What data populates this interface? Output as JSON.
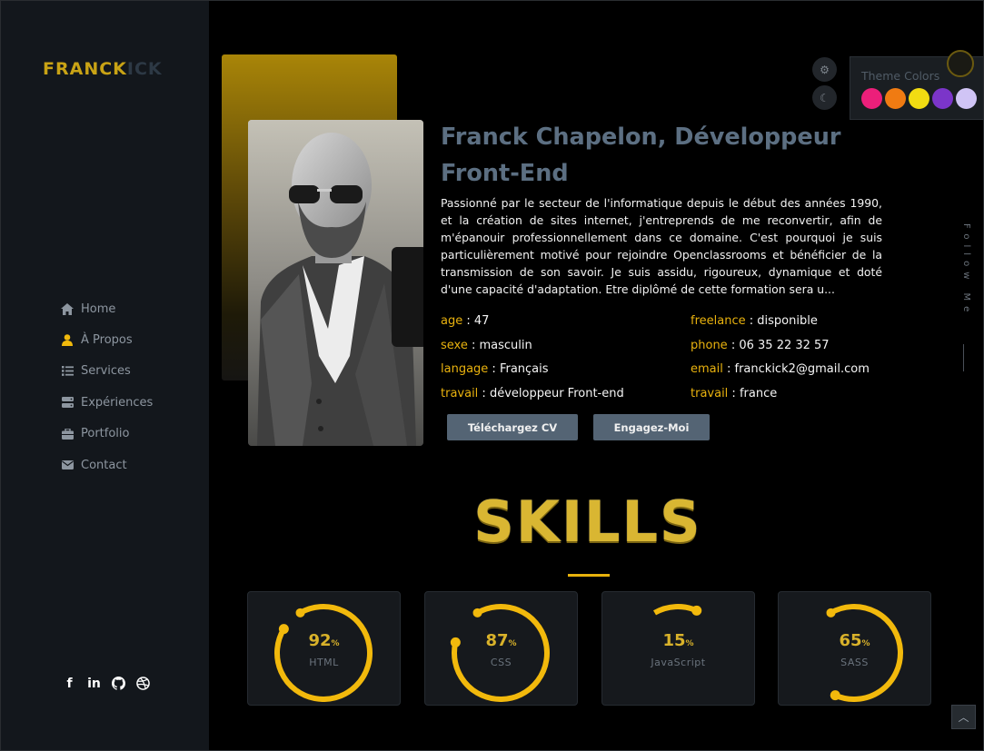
{
  "logo": {
    "part1": "FRANCK",
    "part2": "ICK"
  },
  "nav": [
    {
      "label": "Home",
      "icon": "home-icon"
    },
    {
      "label": "À Propos",
      "icon": "user-icon"
    },
    {
      "label": "Services",
      "icon": "list-icon"
    },
    {
      "label": "Expériences",
      "icon": "server-icon"
    },
    {
      "label": "Portfolio",
      "icon": "briefcase-icon"
    },
    {
      "label": "Contact",
      "icon": "envelope-icon"
    }
  ],
  "socials": [
    "facebook-icon",
    "linkedin-icon",
    "github-icon",
    "dribbble-icon"
  ],
  "hero": {
    "name": "Franck Chapelon, Développeur Front-End",
    "bio": "Passionné par le secteur de l'informatique depuis le début des années 1990, et la création de sites internet, j'entreprends de me reconvertir, afin de m'épanouir professionnellement dans ce domaine. C'est pourquoi je suis particulièrement motivé pour rejoindre Openclassrooms et bénéficier de la transmission de son savoir. Je suis assidu, rigoureux, dynamique et doté d'une capacité d'adaptation. Etre diplômé de cette formation sera u...",
    "info_left": [
      {
        "key": "age",
        "value": "47"
      },
      {
        "key": "sexe",
        "value": "masculin"
      },
      {
        "key": "langage",
        "value": "Français"
      },
      {
        "key": "travail",
        "value": "développeur Front-end"
      }
    ],
    "info_right": [
      {
        "key": "freelance",
        "value": "disponible"
      },
      {
        "key": "phone",
        "value": "06 35 22 32 57"
      },
      {
        "key": "email",
        "value": "franckick2@gmail.com"
      },
      {
        "key": "travail",
        "value": "france"
      }
    ],
    "buttons": {
      "cv": "Téléchargez CV",
      "hire": "Engagez-Moi"
    }
  },
  "theme": {
    "title": "Theme Colors",
    "colors": [
      "#ec1f7a",
      "#f07b12",
      "#f2dc12",
      "#7b35c9",
      "#d0c4f5"
    ]
  },
  "follow": "Follow Me",
  "skills": {
    "title": "SKILLS",
    "accent": "#f2b90c",
    "items": [
      {
        "name": "HTML",
        "percent": 92
      },
      {
        "name": "CSS",
        "percent": 87
      },
      {
        "name": "JavaScript",
        "percent": 15
      },
      {
        "name": "SASS",
        "percent": 65
      }
    ]
  }
}
